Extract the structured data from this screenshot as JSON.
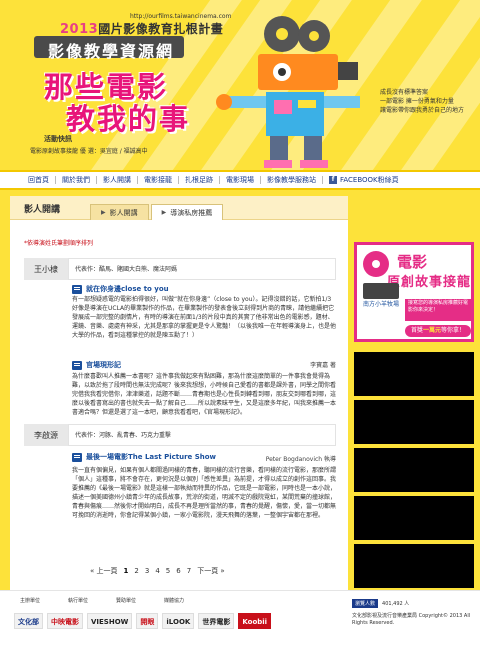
{
  "header": {
    "url": "http://ourfilms.taiwancinema.com",
    "sub_title_year": "2013",
    "sub_title_rest": "國片影像教育扎根計畫",
    "main_title": "影像教學資源網",
    "hero_line1": "那些電影",
    "hero_line2": "教我的事",
    "news_label": "活動快訊",
    "news_text": "電影原創故事接龍 優 選：吳宜庭 / 福誠高中",
    "side_text": [
      "成長沒有標準答案",
      "一部電影 擁一份勇氣和力量",
      "讓電影帶你跟我勇於自己的地方"
    ]
  },
  "nav": {
    "items": [
      "回首頁",
      "關於我們",
      "影人開講",
      "電影接龍",
      "扎根足跡",
      "電影現場",
      "影像教學服務站"
    ],
    "facebook_label": "FACEBOOK粉絲頁"
  },
  "panel": {
    "title": "影人開講",
    "tabs": [
      "影人開講",
      "導演私房推薦"
    ],
    "note": "*依導演姓氏筆劃順序排列",
    "entries": [
      {
        "name": "王小棣",
        "info": "代表作：酷馬、賭國大白熊、魔法阿媽",
        "items": [
          {
            "title": "就在你身邊close to you",
            "author": "",
            "text": "有一部想疑惑電的電影拍得很好，叫做“就在你身邊”（close to you）。記得沒錯的話，它新拍1/3好像是導演在UCLA的畢業製作的作品，在畢業製作的發表會後立刻得到片商的青睞，請他繼續把它發展成一部完整的劇情片，有時的導演在前面1/3的片段中真的其實了他非常出色的電影感，題材、運鏡、音樂、處處有神采，尤其是那拿的掌握更是令人驚豔！（以後我唯一在年輕導演身上，也是他大學的作品，看到這種掌控的就是陳玉勳了！）"
          },
          {
            "title": "官場現形記",
            "author": "李寶嘉 著",
            "text": "為什麼喜歡叫人推薦一本書呢？這件事我做起來有點困難，那為什麼這麼簡單的一件事我會覺得為難，以致於拖了段時間也無法完成呢？後來我想想，小時候自己愛看的書都是課外書，同學之間你看完借我我看完借你，津津樂道，話題不斷……青春期也是心性長到轉看到哪，朋友交到哪看到哪，這麼以後看書寫出的書也就失去一點了解自己……所以說素昧平生，又是這麼多年紀，叫我來推薦一本書適合嗎？但還是選了這一本吧，顧意我看看吧，《官場現形記》。"
          }
        ]
      },
      {
        "name": "李啟源",
        "info": "代表作：河豚、亂青春、巧克力重擊",
        "items": [
          {
            "title": "最後一場電影The Last Picture Show",
            "author": "Peter Bogdanovich 執導",
            "text": "我一直有個偏見，如果有個人都關過同樣的青春，聽同樣的流行音樂，看同樣的流行電影，那麼所謂「個人」這種事，將不會存在，更何況是以個別「感性差異」為前提，才得以成立的創作這回事。我要推薦的《最後一場電影》就是這樣一部執拗而特異的作品，它既是一部電影，同時也是一本小說，描述一個美國德州小鎮青少年的成長故事，荒涼的街道，明滅不定的戲院霓虹，某間荒棄的撞球館，青春與傷痕……然後你才開始明白，成長不再是理所當然的事，青春的覺醒，傷懷，愛，當一切都無可挽回的消逝時，你會記得某個小鎮，一家小電影院，漫天飛舞的落葉，一整個宇宙都在那裡。"
          }
        ]
      }
    ],
    "pager": {
      "prev": "上一頁",
      "pages": [
        "1",
        "2",
        "3",
        "4",
        "5",
        "6",
        "7"
      ],
      "current_page": "1",
      "next": "下一頁"
    }
  },
  "sidebar": {
    "ad_title": "電影",
    "ad_sub": "原創故事接龍",
    "ad_hand": "南方小羊牧場",
    "ad_box_text": "接寫您的導演私房推薦好電影你來決定！",
    "ad_cta_prefix": "首獎",
    "ad_cta_highlight": "一萬元",
    "ad_cta_suffix": "等你拿！"
  },
  "footer": {
    "sponsor_labels": [
      "主辦單位",
      "執行單位",
      "贊助單位",
      "媒體協力"
    ],
    "logos": [
      "文化部",
      "中映電影",
      "VIESHOW",
      "開眼",
      "iLOOK",
      "世界電影",
      "Koobii"
    ],
    "visitor_label": "瀏覽人數",
    "visitor_count": "401,492 人",
    "copyright": "文化部影視及流行音樂產業局 Copyright© 2013 All Rights Reserved."
  }
}
